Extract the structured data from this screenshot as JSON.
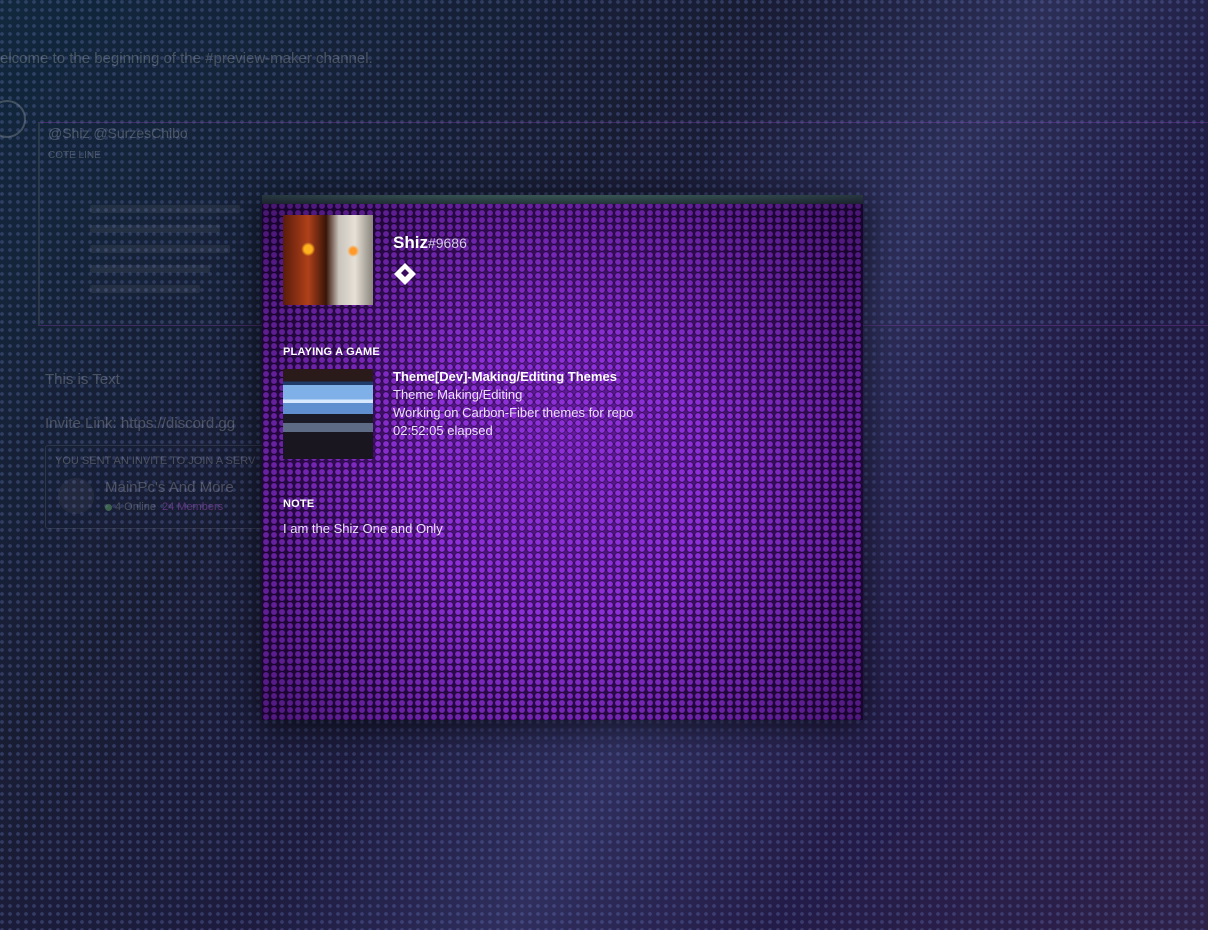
{
  "background_chat": {
    "welcome": "elcome to the beginning of the #preview-maker channel.",
    "mention": "@Shiz @SurzesChibo",
    "embed_caption": "COTE LINE",
    "text_message": "This is Text",
    "invite_message": "Invite Link: https://discord.gg",
    "invite_header": "YOU SENT AN INVITE TO JOIN A SERV",
    "server_name": "MainPc's And More",
    "server_online": "4 Online",
    "server_members": "24 Members"
  },
  "profile": {
    "username": "Shiz",
    "discriminator": "#9686",
    "badge_icon": "hypesquad-icon",
    "activity": {
      "header": "PLAYING A GAME",
      "name": "Theme[Dev]-Making/Editing Themes",
      "details": "Theme Making/Editing",
      "state": "Working on Carbon-Fiber themes for repo",
      "elapsed": "02:52:05 elapsed"
    },
    "note": {
      "header": "NOTE",
      "text": "I am the Shiz One and Only"
    }
  },
  "colors": {
    "modal_purple": "#8d2fd6",
    "topbar_teal": "#4c7a6d",
    "background_navy": "#1a1f3a"
  }
}
